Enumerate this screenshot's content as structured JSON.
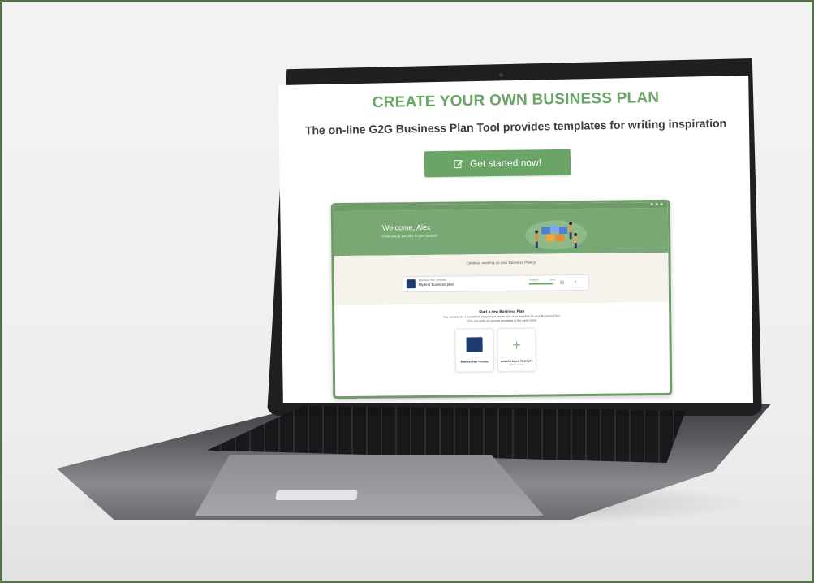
{
  "page": {
    "title": "CREATE YOUR OWN BUSINESS PLAN",
    "subtitle": "The on-line G2G Business Plan Tool provides templates for writing inspiration",
    "cta_label": "Get started now!"
  },
  "app": {
    "welcome_title": "Welcome, Alex",
    "welcome_sub": "How would you like to get started?",
    "continue_label": "Continue working on your Business Plan(s)",
    "plan": {
      "kicker": "Business Plan Template",
      "name": "My first business plan",
      "progress_label": "Progress",
      "progress_value": "100%",
      "progress_fraction": 0.9
    },
    "new_plan": {
      "title": "Start a new Business Plan",
      "desc_line1": "You can choose a predefined template or create your own template for your Business Plan.",
      "desc_line2": "(You can work on several templates at the same time)"
    },
    "templates": [
      {
        "label": "Business Plan Template"
      },
      {
        "label": "CUSTOM BUILD TEMPLATE",
        "sub": "Create your own"
      }
    ]
  },
  "colors": {
    "accent": "#6aa467",
    "frame": "#56704c",
    "brand_blue": "#1e3a6e"
  }
}
